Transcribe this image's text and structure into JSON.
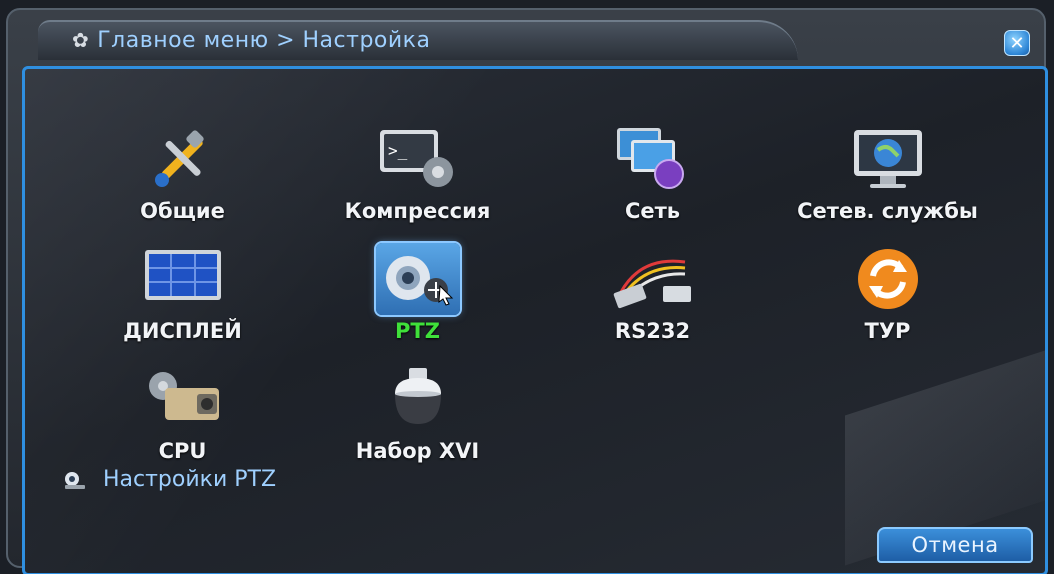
{
  "window": {
    "title": "Главное меню > Настройка",
    "gear_icon": "gear-icon",
    "close_label": "✕"
  },
  "menu": {
    "items": [
      {
        "label": "Общие",
        "icon": "tools-icon"
      },
      {
        "label": "Компрессия",
        "icon": "console-gear-icon"
      },
      {
        "label": "Сеть",
        "icon": "network-monitors-icon"
      },
      {
        "label": "Сетев. службы",
        "icon": "globe-monitor-icon"
      },
      {
        "label": "ДИСПЛЕЙ",
        "icon": "display-grid-icon"
      },
      {
        "label": "PTZ",
        "icon": "ptz-camera-icon",
        "selected": true
      },
      {
        "label": "RS232",
        "icon": "serial-cable-icon"
      },
      {
        "label": "ТУР",
        "icon": "refresh-cycle-icon"
      },
      {
        "label": "CPU",
        "icon": "cctv-camera-icon"
      },
      {
        "label": "Набор XVI",
        "icon": "dome-camera-icon"
      }
    ]
  },
  "status": {
    "text": "Настройки PTZ",
    "icon": "ptz-small-icon"
  },
  "footer": {
    "cancel_label": "Отмена"
  },
  "colors": {
    "accent": "#2f8fe0",
    "selected_label": "#3fe03a",
    "title_text": "#9fd0ff"
  }
}
